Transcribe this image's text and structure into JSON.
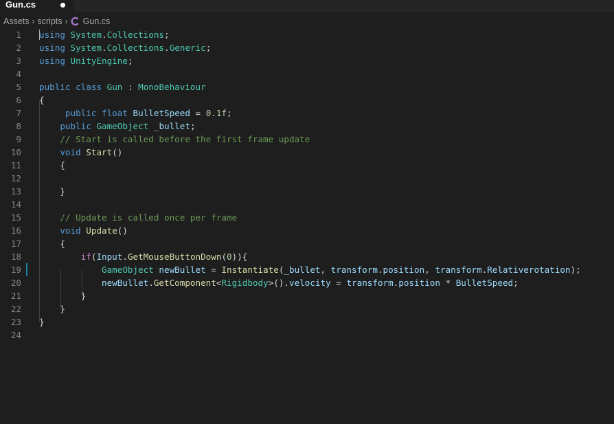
{
  "tab": {
    "label": "Gun.cs"
  },
  "breadcrumb": {
    "items": [
      "Assets",
      "scripts",
      "Gun.cs"
    ]
  },
  "colors": {
    "background": "#1e1e1e",
    "keyword": "#569cd6",
    "control": "#c586c0",
    "type": "#4ec9b0",
    "function": "#dcdcaa",
    "number": "#b5cea8",
    "comment": "#6a9955",
    "modified_gutter": "#1b81a8"
  },
  "lines": [
    "using System.Collections;",
    "using System.Collections.Generic;",
    "using UnityEngine;",
    "",
    "public class Gun : MonoBehaviour",
    "{",
    "     public float BulletSpeed = 0.1f;",
    "    public GameObject _bullet;",
    "    // Start is called before the first frame update",
    "    void Start()",
    "    {",
    "",
    "    }",
    "",
    "    // Update is called once per frame",
    "    void Update()",
    "    {",
    "        if(Input.GetMouseButtonDown(0)){",
    "            GameObject newBullet = Instantiate(_bullet, transform.position, transform.Relativerotation);",
    "            newBullet.GetComponent<Rigidbody>().velocity = transform.position * BulletSpeed;",
    "        }",
    "    }",
    "}",
    ""
  ]
}
